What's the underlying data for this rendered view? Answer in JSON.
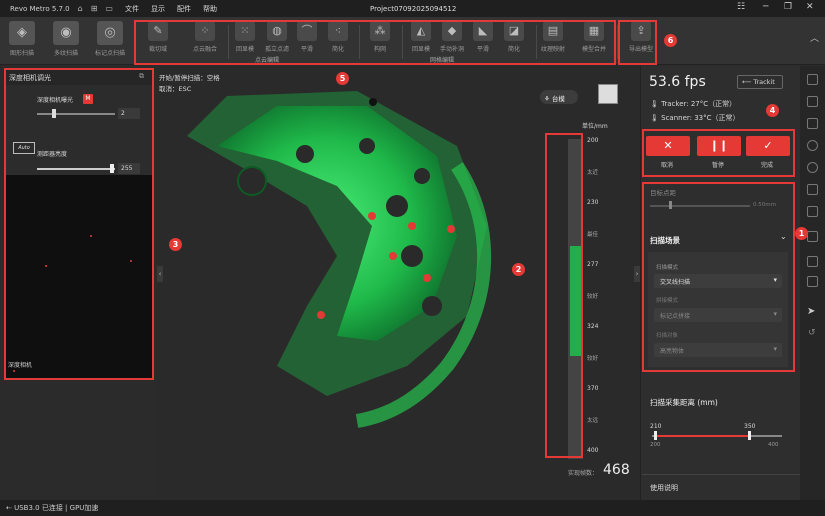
{
  "titlebar": {
    "app_name": "Revo Metro 5.7.0",
    "project": "Project07092025094512",
    "menu": [
      "文件",
      "显示",
      "配件",
      "帮助"
    ]
  },
  "toolbar": {
    "big_buttons": [
      "图形扫描",
      "多纹扫描",
      "标记点扫描"
    ],
    "edit_group_label": "点云编辑",
    "mesh_group_label": "网格编辑",
    "edit_tools": [
      "裁切域",
      "点云融合",
      "回显模",
      "孤立点滤",
      "平滑",
      "简化"
    ],
    "mesh_tools": [
      "构网",
      "回显模",
      "手动补洞",
      "平滑",
      "简化",
      "纹理映射",
      "模型合并",
      "导出模型"
    ]
  },
  "left_panel": {
    "header": "深度相机调光",
    "exposure_label": "深度相机曝光",
    "exposure_badge": "M",
    "exposure_value": "2",
    "brightness_label": "测距器亮度",
    "brightness_value": "255",
    "camera_label": "深度相机",
    "auto_badge": "Auto"
  },
  "viewport": {
    "mode_line1": "开始/暂停扫描：空格",
    "mode_line2": "取消：ESC",
    "view_button": "台模",
    "unit": "单位/mm",
    "scale_ticks": [
      "200",
      "230",
      "277",
      "324",
      "370",
      "400"
    ],
    "scale_words": [
      "太近",
      "最佳",
      "较好",
      "太远"
    ],
    "points_label": "实现帧数：",
    "points_value": "468"
  },
  "right_panel": {
    "fps": "53.6 fps",
    "trackit_label": "Trackit",
    "tracker_temp": "Tracker: 27°C（正常）",
    "scanner_temp": "Scanner: 33°C（正常）",
    "actions": [
      {
        "label": "取消",
        "icon": "✕"
      },
      {
        "label": "暂停",
        "icon": "❙❙"
      },
      {
        "label": "完成",
        "icon": "✓"
      }
    ],
    "point_distance_label": "目标点距",
    "point_distance_value": "0.50mm",
    "scene_title": "扫描场景",
    "scene_fields": [
      {
        "caption": "扫描模式",
        "value": "交叉线扫描",
        "dim": false
      },
      {
        "caption": "拼接模式",
        "value": "标记点拼接",
        "dim": true
      },
      {
        "caption": "扫描对象",
        "value": "高亮物体",
        "dim": true
      }
    ],
    "distance_title": "扫描采集距离 (mm)",
    "distance_low": "210",
    "distance_high": "350",
    "distance_min": "200",
    "distance_max": "400",
    "usage_tips": "使用说明"
  },
  "status": {
    "text": "USB3.0 已连接 | GPU加速"
  },
  "markers": [
    "1",
    "2",
    "3",
    "4",
    "5",
    "6"
  ],
  "colors": {
    "accent_red": "#e53935",
    "scan_green": "#2ecc40"
  }
}
